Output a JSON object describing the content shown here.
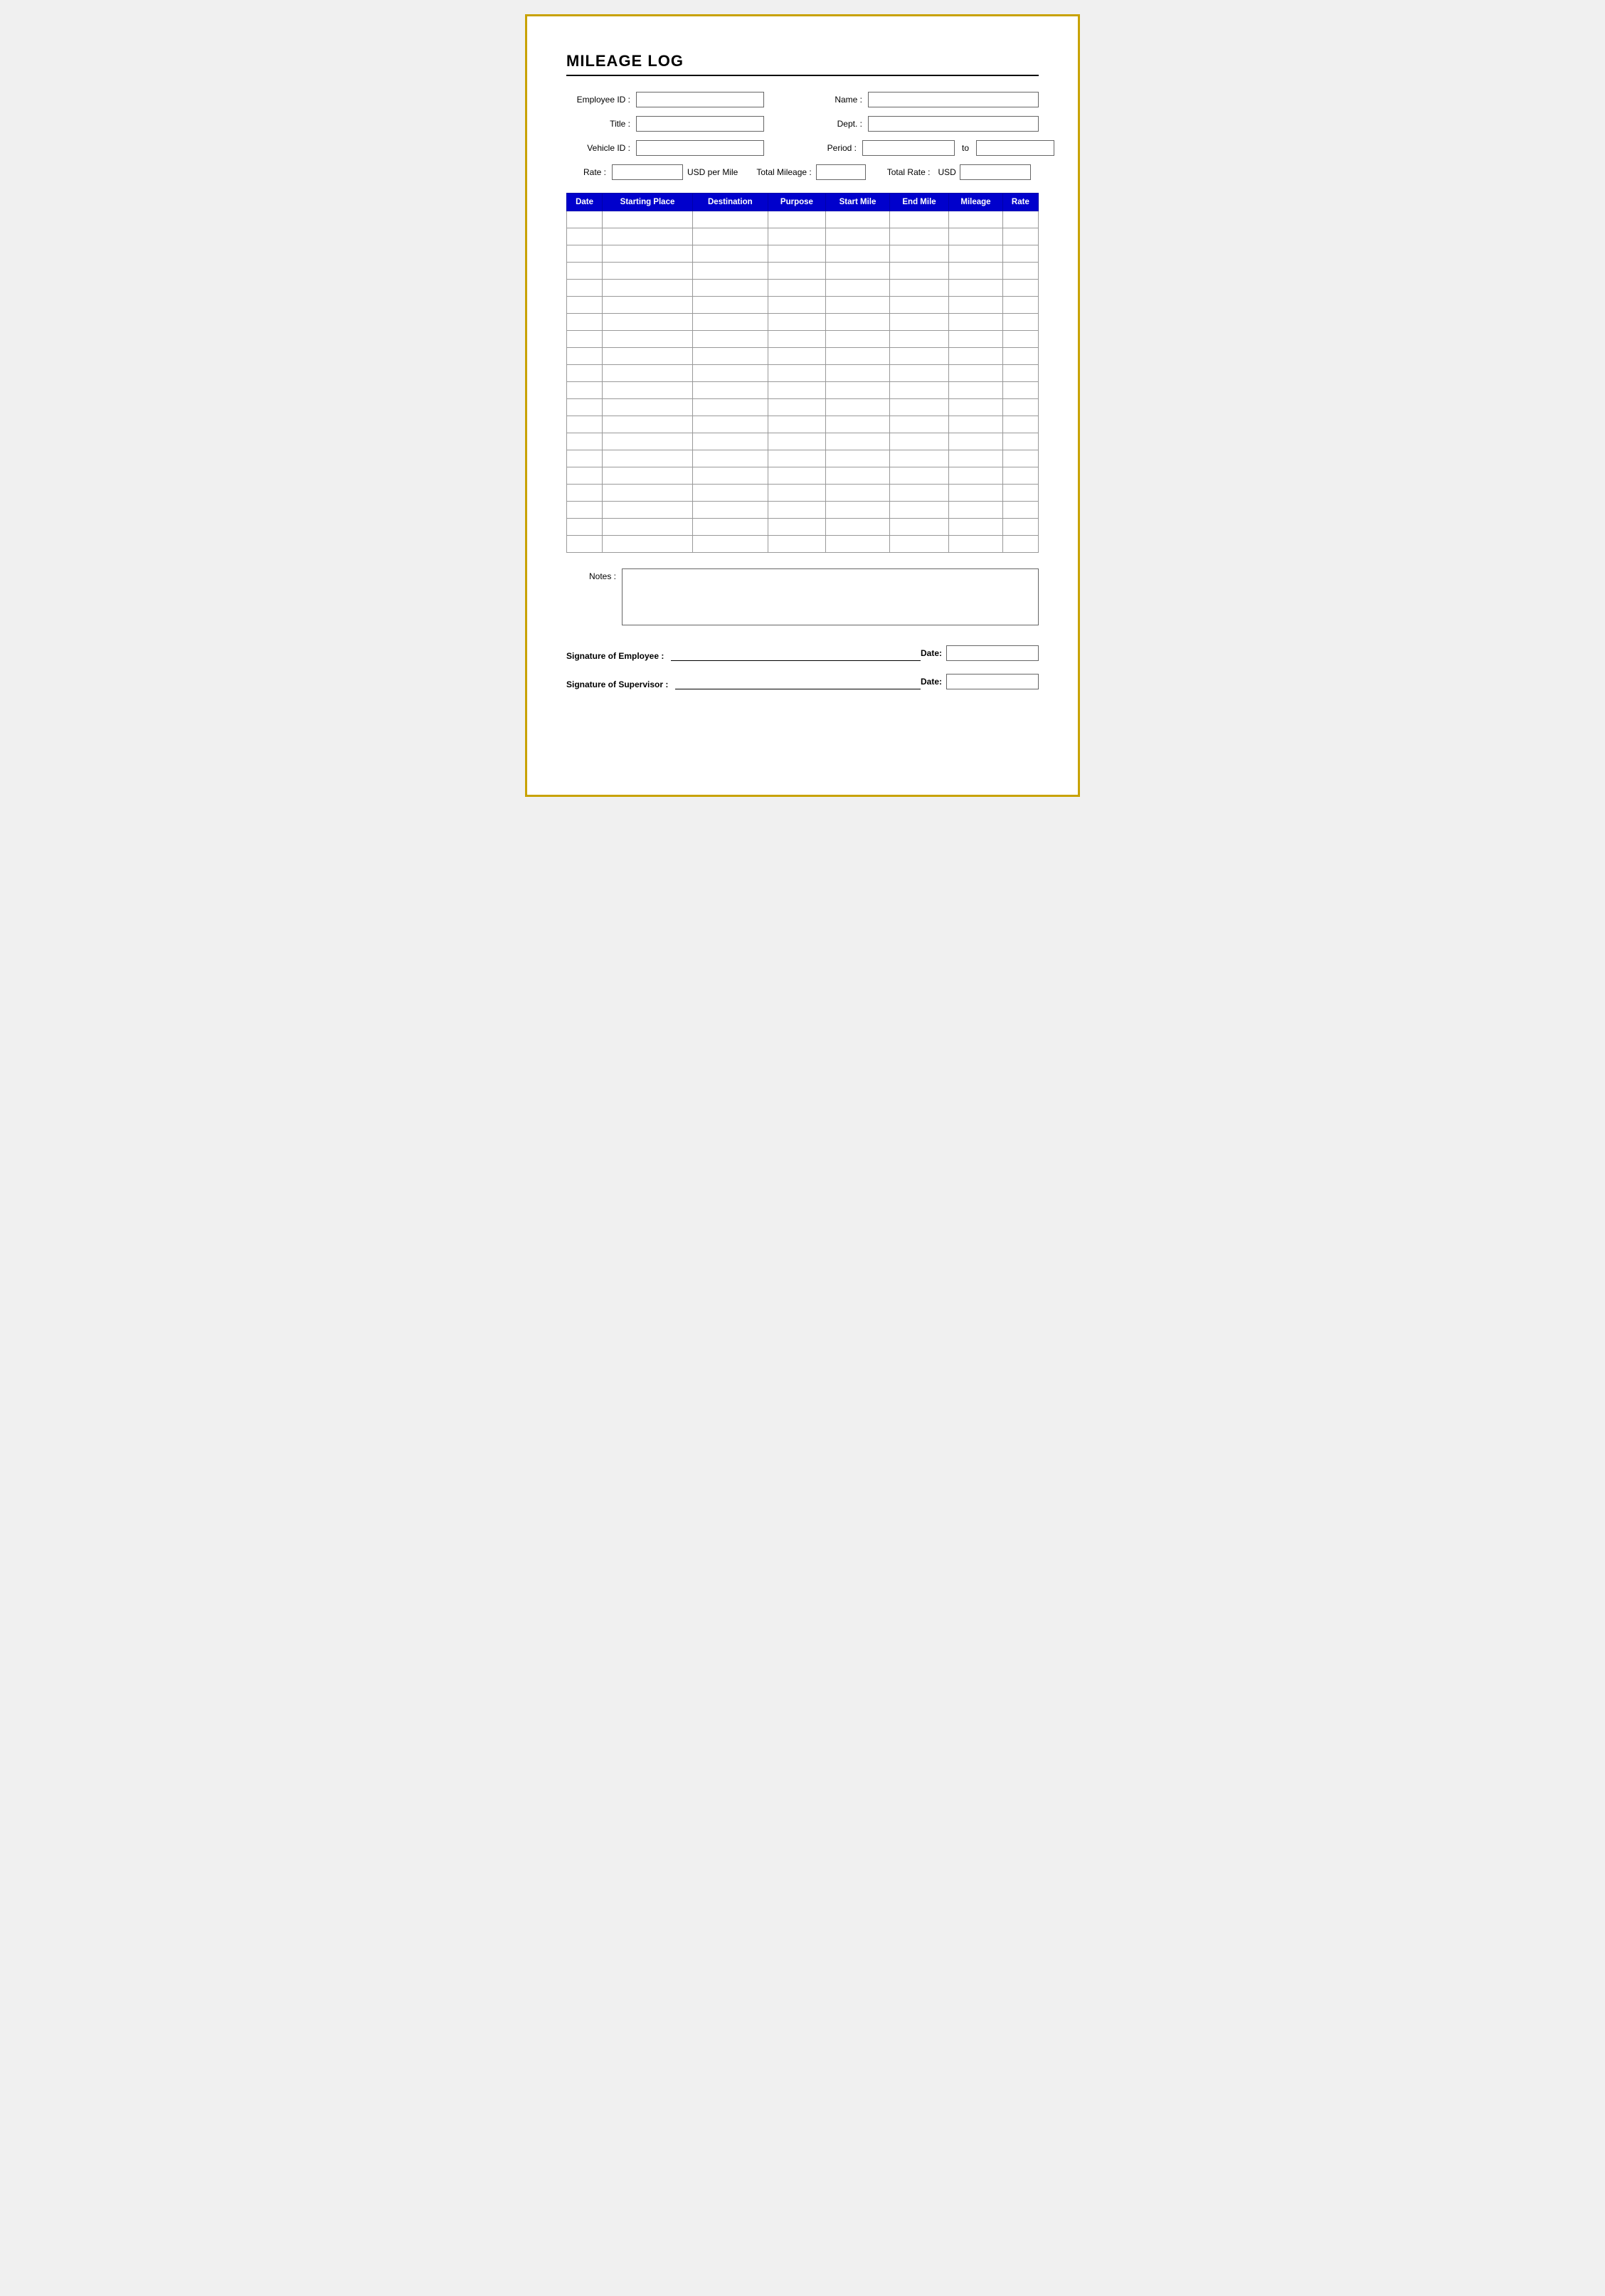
{
  "page": {
    "title": "MILEAGE LOG"
  },
  "form": {
    "employee_id_label": "Employee ID :",
    "name_label": "Name :",
    "title_label": "Title :",
    "dept_label": "Dept. :",
    "vehicle_id_label": "Vehicle ID :",
    "period_label": "Period :",
    "to_label": "to",
    "rate_label": "Rate :",
    "usd_per_mile_label": "USD per Mile",
    "total_mileage_label": "Total Mileage :",
    "total_rate_label": "Total Rate :",
    "usd_label": "USD"
  },
  "table": {
    "headers": [
      "Date",
      "Starting Place",
      "Destination",
      "Purpose",
      "Start Mile",
      "End Mile",
      "Mileage",
      "Rate"
    ],
    "row_count": 20
  },
  "notes": {
    "label": "Notes :"
  },
  "signatures": {
    "employee_label": "Signature of Employee :",
    "supervisor_label": "Signature of Supervisor :",
    "date_label": "Date:"
  }
}
